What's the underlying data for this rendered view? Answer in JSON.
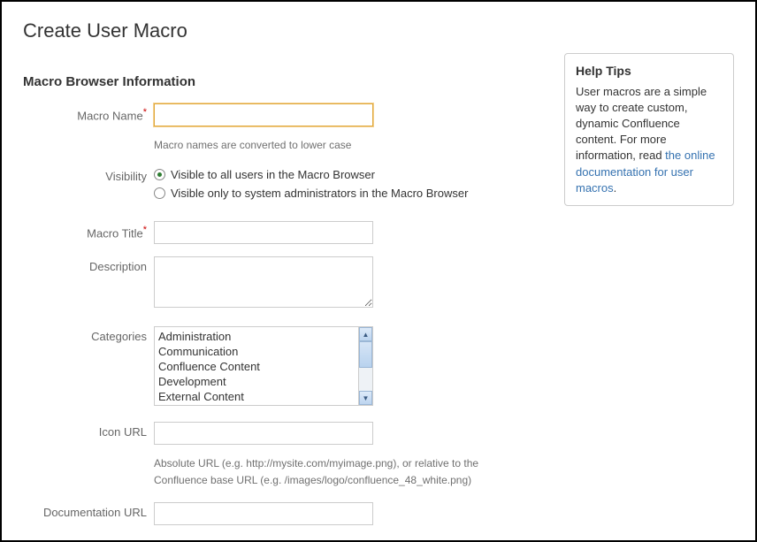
{
  "page_title": "Create User Macro",
  "section_heading": "Macro Browser Information",
  "required_mark": "*",
  "fields": {
    "macro_name": {
      "label": "Macro Name",
      "value": "",
      "helper": "Macro names are converted to lower case"
    },
    "visibility": {
      "label": "Visibility",
      "options": {
        "all": "Visible to all users in the Macro Browser",
        "admins": "Visible only to system administrators in the Macro Browser"
      }
    },
    "macro_title": {
      "label": "Macro Title",
      "value": ""
    },
    "description": {
      "label": "Description",
      "value": ""
    },
    "categories": {
      "label": "Categories",
      "options": [
        "Administration",
        "Communication",
        "Confluence Content",
        "Development",
        "External Content"
      ]
    },
    "icon_url": {
      "label": "Icon URL",
      "value": "",
      "helper": "Absolute URL (e.g. http://mysite.com/myimage.png), or relative to the Confluence base URL (e.g. /images/logo/confluence_48_white.png)"
    },
    "documentation_url": {
      "label": "Documentation URL",
      "value": ""
    }
  },
  "help": {
    "title": "Help Tips",
    "body_before_link": "User macros are a simple way to create custom, dynamic Confluence content. For more information, read ",
    "link_text": "the online documentation for user macros",
    "body_after_link": "."
  }
}
